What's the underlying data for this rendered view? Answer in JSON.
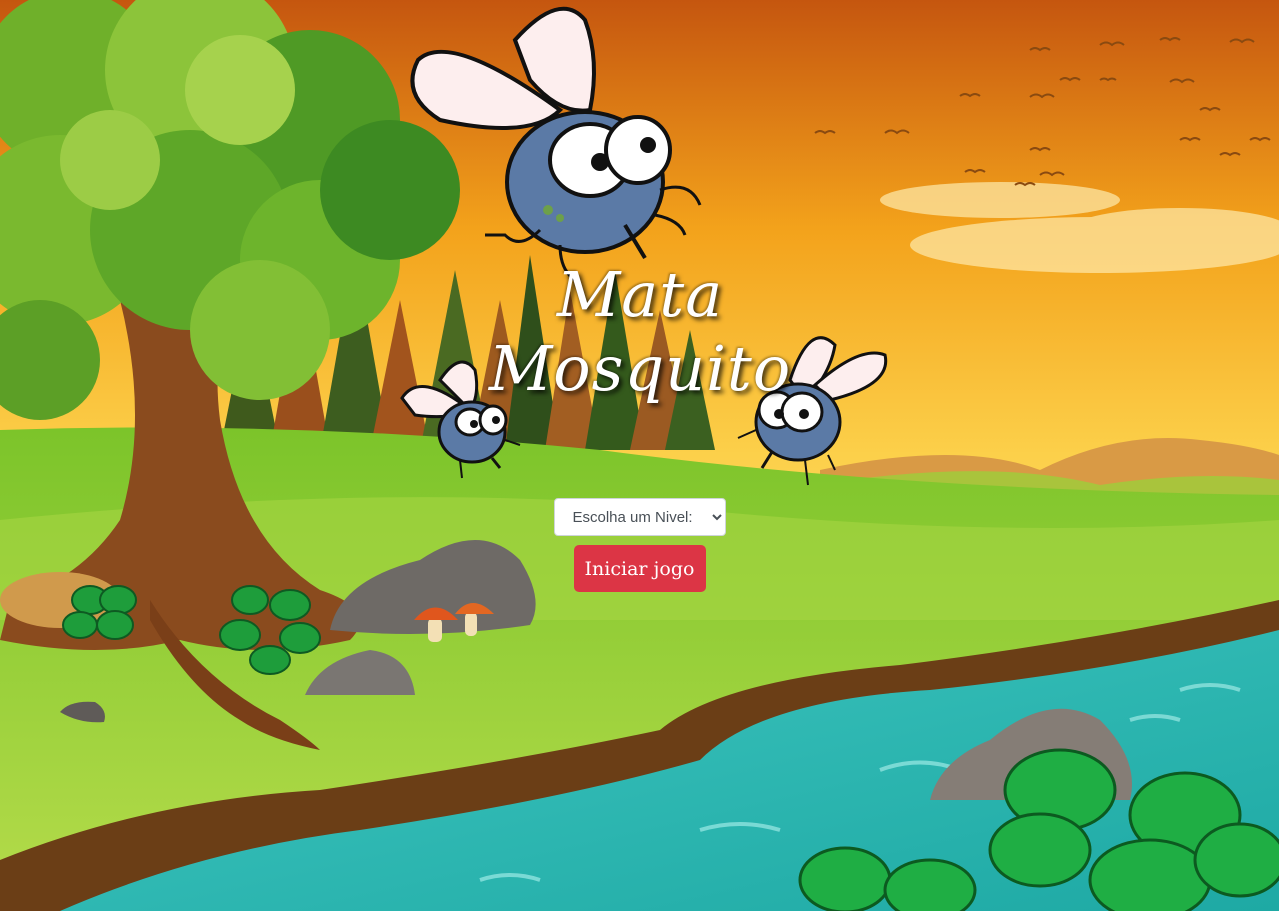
{
  "game": {
    "title_line1": "Mata",
    "title_line2": "Mosquito"
  },
  "menu": {
    "level_select": {
      "selected_label": "Escolha um Nivel:",
      "options": [
        "Escolha um Nivel:"
      ]
    },
    "start_button_label": "Iniciar jogo"
  },
  "colors": {
    "start_button": "#dc3545",
    "sky_top": "#c7570f",
    "sky_bottom": "#fde7a0",
    "grass": "#8fcf2f",
    "river": "#2fb9b3",
    "mosquito_body": "#5b7aa6"
  },
  "icons": [
    "mosquito-icon",
    "tree-icon",
    "rock-icon",
    "mushroom-icon",
    "leaf-plant-icon",
    "bird-icon"
  ]
}
